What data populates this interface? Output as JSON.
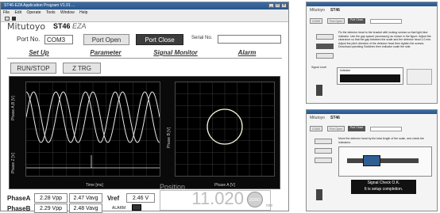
{
  "window": {
    "title": "ST46-EZA Application Program V1.01 ...",
    "menu": [
      "File",
      "Edit",
      "Operate",
      "Tools",
      "Window",
      "Help"
    ]
  },
  "header": {
    "logo": "Mitutoyo",
    "model": "ST46",
    "model_suffix": "EZA",
    "port_label": "Port No.",
    "port_value": "COM3",
    "port_open": "Port Open",
    "port_close": "Port Close",
    "serial_label": "Serial No."
  },
  "tabs": [
    "Set Up",
    "Parameter",
    "Signal Monitor",
    "Alarm"
  ],
  "scope": {
    "run_stop": "RUN/STOP",
    "z_trg": "Z TRG",
    "left_ylabel_top": "Phase A,B [V]",
    "left_ylabel_bottom": "Phase Z [V]",
    "left_xlabel": "Time [ms]",
    "right_ylabel": "Phase B [V]",
    "right_xlabel": "Phase A [V]"
  },
  "readout": {
    "phaseA_label": "PhaseA",
    "phaseA_vpp": "2.28 Vpp",
    "phaseA_vavg": "2.47 Vavg",
    "phaseB_label": "PhaseB",
    "phaseB_vpp": "2.29 Vpp",
    "phaseB_vavg": "2.48 Vavg",
    "vref_label": "Vref",
    "vref_value": "2.46 V",
    "alarm_label": "ALARM",
    "position_label": "Position",
    "position_value": "11.020",
    "zero_button": "ZERO",
    "unit": "mm"
  },
  "dialog_top": {
    "instructions": "Fix the detector head to the bracket with locking screws so that light blue indicator. Use the gap spacer (accessory) as shown in the figure. Adjust the clearance so that the gap between the scale and the detector head 1.0 mm. Adjust the pitch direction of the detector head then tighten the screws. Download operating Switches then indicator scale the side.",
    "signal_label": "Signal Level",
    "indicator_label": "Indicator"
  },
  "dialog_bottom": {
    "instructions": "Move the detector head by the total length of the scale, and check the indicators.",
    "status_line1": "Signal Check O.K.",
    "status_line2": "It is setup completion."
  },
  "colors": {
    "scope_bg": "#000000",
    "wave": "#e8e8e8",
    "lissajous": "#f2f2d8",
    "grid": "#3a3a3a",
    "title_bar": "#2f5e93"
  }
}
